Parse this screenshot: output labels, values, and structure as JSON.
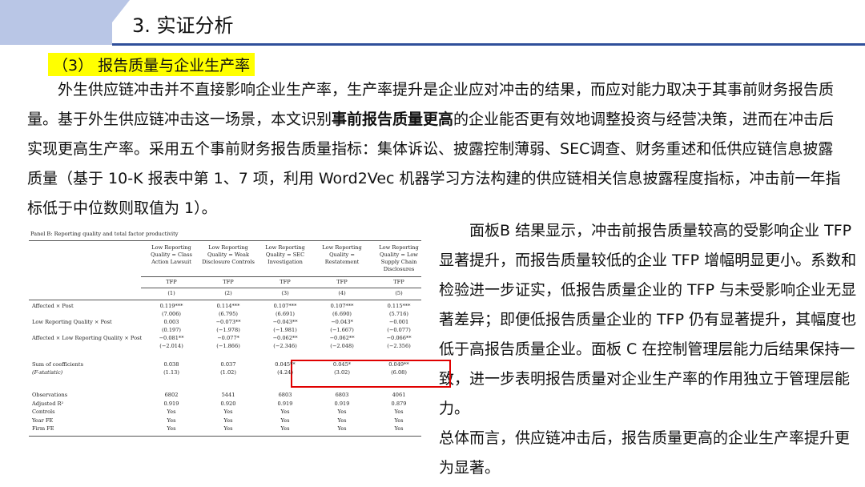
{
  "header": {
    "title": "3. 实证分析"
  },
  "subtitle": "（3） 报告质量与企业生产率",
  "para1": {
    "a": "外生供应链冲击并不直接影响企业生产率，生产率提升是企业应对冲击的结果，而应对能力取决于其事前财务报告质量。基于外生供应链冲击这一场景，本文识别",
    "bold": "事前报告质量更高",
    "b": "的企业能否更有效地调整投资与经营决策，进而在冲击后实现更高生产率。采用五个事前财务报告质量指标：集体诉讼、披露控制薄弱、SEC调查、财务重述和低供应链信息披露质量（基于 10-K 报表中第 1、7 项，利用 Word2Vec 机器学习方法构建的供应链相关信息披露程度指标，冲击前一年指标低于中位数则取值为 1）。"
  },
  "right": {
    "p1": "面板B 结果显示，冲击前报告质量较高的受影响企业 TFP 显著提升，而报告质量较低的企业 TFP 增幅明显更小。系数和检验进一步证实，低报告质量企业的 TFP 与未受影响企业无显著差异；即便低报告质量企业的 TFP 仍有显著提升，其幅度也低于高报告质量企业。面板 C 在控制管理层能力后结果保持一致，进一步表明报告质量对企业生产率的作用独立于管理层能力。",
    "p2": "总体而言，供应链冲击后，报告质量更高的企业生产率提升更为显著。"
  },
  "table": {
    "caption": "Panel B: Reporting quality and total factor productivity",
    "headers": [
      "Low Reporting Quality = Class Action Lawsuit",
      "Low Reporting Quality = Weak Disclosure Controls",
      "Low Reporting Quality = SEC Investigation",
      "Low Reporting Quality = Restatement",
      "Low Reporting Quality = Low Supply Chain Disclosures"
    ],
    "dep": [
      "TFP",
      "TFP",
      "TFP",
      "TFP",
      "TFP"
    ],
    "nums": [
      "(1)",
      "(2)",
      "(3)",
      "(4)",
      "(5)"
    ],
    "rows": [
      {
        "label": "Affected × Post",
        "v": [
          "0.119***",
          "0.114***",
          "0.107***",
          "0.107***",
          "0.115***"
        ],
        "t": [
          "(7.006)",
          "(6.795)",
          "(6.691)",
          "(6.690)",
          "(5.716)"
        ]
      },
      {
        "label": "Low Reporting Quality × Post",
        "v": [
          "0.003",
          "−0.073**",
          "−0.043**",
          "−0.043*",
          "−0.001"
        ],
        "t": [
          "(0.197)",
          "(−1.978)",
          "(−1.981)",
          "(−1.667)",
          "(−0.077)"
        ]
      },
      {
        "label": "Affected × Low Reporting Quality × Post",
        "v": [
          "−0.081**",
          "−0.077*",
          "−0.062**",
          "−0.062**",
          "−0.066**"
        ],
        "t": [
          "(−2.014)",
          "(−1.866)",
          "(−2.346)",
          "(−2.048)",
          "(−2.356)"
        ]
      },
      {
        "label": "Sum of coefficients",
        "label2": "(F-statistic)",
        "v": [
          "0.038",
          "0.037",
          "0.045**",
          "0.045*",
          "0.049**"
        ],
        "t": [
          "(1.13)",
          "(1.02)",
          "(4.24)",
          "(3.02)",
          "(6.08)"
        ]
      }
    ],
    "stats": [
      {
        "label": "Observations",
        "v": [
          "6802",
          "5441",
          "6803",
          "6803",
          "4061"
        ]
      },
      {
        "label": "Adjusted R²",
        "v": [
          "0.919",
          "0.920",
          "0.919",
          "0.919",
          "0.879"
        ]
      },
      {
        "label": "Controls",
        "v": [
          "Yes",
          "Yes",
          "Yes",
          "Yes",
          "Yes"
        ]
      },
      {
        "label": "Year FE",
        "v": [
          "Yes",
          "Yes",
          "Yes",
          "Yes",
          "Yes"
        ]
      },
      {
        "label": "Firm FE",
        "v": [
          "Yes",
          "Yes",
          "Yes",
          "Yes",
          "Yes"
        ]
      }
    ]
  }
}
